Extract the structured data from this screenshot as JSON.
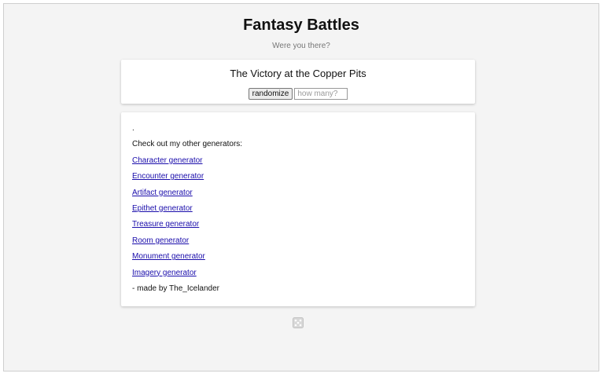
{
  "page": {
    "title": "Fantasy Battles",
    "subtitle": "Were you there?"
  },
  "generator": {
    "result": "The Victory at the Copper Pits",
    "randomize_label": "randomize",
    "count_placeholder": "how many?",
    "count_value": ""
  },
  "info": {
    "dot": ".",
    "intro": "Check out my other generators:",
    "links": [
      "Character generator",
      "Encounter generator",
      "Artifact generator",
      "Epithet generator",
      "Treasure generator",
      "Room generator",
      "Monument generator",
      "Imagery generator"
    ],
    "credit": "- made by The_Icelander"
  },
  "footer": {
    "icon": "dice-icon"
  }
}
